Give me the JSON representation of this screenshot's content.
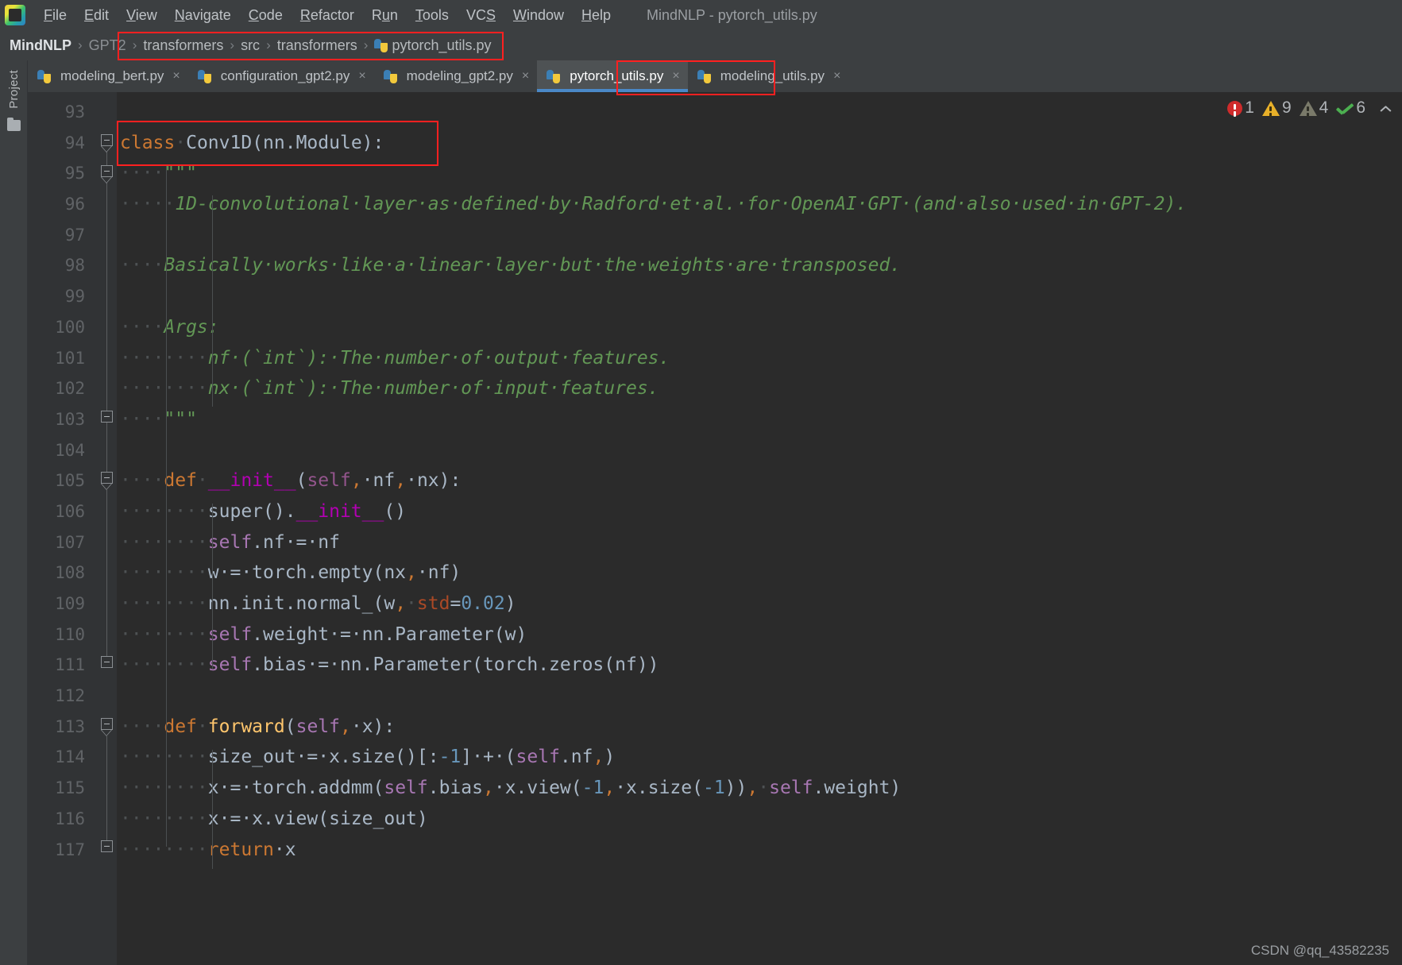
{
  "window": {
    "title": "MindNLP - pytorch_utils.py",
    "app_icon": "pycharm-logo-icon"
  },
  "menubar": {
    "items": [
      {
        "label": "File",
        "mnemonic": "F"
      },
      {
        "label": "Edit",
        "mnemonic": "E"
      },
      {
        "label": "View",
        "mnemonic": "V"
      },
      {
        "label": "Navigate",
        "mnemonic": "N"
      },
      {
        "label": "Code",
        "mnemonic": "C"
      },
      {
        "label": "Refactor",
        "mnemonic": "R"
      },
      {
        "label": "Run",
        "mnemonic": "u"
      },
      {
        "label": "Tools",
        "mnemonic": "T"
      },
      {
        "label": "VCS",
        "mnemonic": "S"
      },
      {
        "label": "Window",
        "mnemonic": "W"
      },
      {
        "label": "Help",
        "mnemonic": "H"
      }
    ]
  },
  "breadcrumb": {
    "separator": "›",
    "items": [
      {
        "label": "MindNLP",
        "style": "root",
        "icon": null
      },
      {
        "label": "GPT2",
        "style": "dim",
        "icon": null
      },
      {
        "label": "transformers",
        "style": "plain",
        "icon": null
      },
      {
        "label": "src",
        "style": "plain",
        "icon": null
      },
      {
        "label": "transformers",
        "style": "plain",
        "icon": null
      },
      {
        "label": "pytorch_utils.py",
        "style": "plain",
        "icon": "python-file-icon"
      }
    ]
  },
  "tabs": [
    {
      "label": "modeling_bert.py",
      "icon": "python-file-icon",
      "active": false,
      "close": "×"
    },
    {
      "label": "configuration_gpt2.py",
      "icon": "python-file-icon",
      "active": false,
      "close": "×"
    },
    {
      "label": "modeling_gpt2.py",
      "icon": "python-file-icon",
      "active": false,
      "close": "×"
    },
    {
      "label": "pytorch_utils.py",
      "icon": "python-file-icon",
      "active": true,
      "close": "×"
    },
    {
      "label": "modeling_utils.py",
      "icon": "python-file-icon",
      "active": false,
      "close": "×"
    }
  ],
  "toolwindow": {
    "project_label": "Project",
    "folder_icon": "folder-icon"
  },
  "inspections": {
    "error_count": "1",
    "warning_count": "9",
    "weak_warning_count": "4",
    "ok_count": "6",
    "collapse_icon": "chevron-up-icon",
    "error_color": "#cf2b2b",
    "warning_color": "#e8b029",
    "weak_warning_color": "#7a7a6a",
    "ok_color": "#4caf50"
  },
  "editor": {
    "first_line_number": 93,
    "line_numbers": [
      93,
      94,
      95,
      96,
      97,
      98,
      99,
      100,
      101,
      102,
      103,
      104,
      105,
      106,
      107,
      108,
      109,
      110,
      111,
      112,
      113,
      114,
      115,
      116,
      117
    ],
    "lines": [
      {
        "n": 93,
        "tokens": []
      },
      {
        "n": 94,
        "tokens": [
          {
            "t": "class",
            "c": "kw"
          },
          {
            "t": "·",
            "c": "ws"
          },
          {
            "t": "Conv1D(nn.Module):",
            "c": "cls"
          }
        ]
      },
      {
        "n": 95,
        "tokens": [
          {
            "t": "····",
            "c": "ws"
          },
          {
            "t": "\"\"\"",
            "c": "doc"
          }
        ]
      },
      {
        "n": 96,
        "tokens": [
          {
            "t": "·····",
            "c": "ws"
          },
          {
            "t": "1D-convolutional·layer·as·defined·by·Radford·et·al.·for·OpenAI·GPT·(and·also·used·in·GPT-2).",
            "c": "doc"
          }
        ]
      },
      {
        "n": 97,
        "tokens": []
      },
      {
        "n": 98,
        "tokens": [
          {
            "t": "····",
            "c": "ws"
          },
          {
            "t": "Basically·works·like·a·linear·layer·but·the·weights·are·transposed.",
            "c": "doc"
          }
        ]
      },
      {
        "n": 99,
        "tokens": []
      },
      {
        "n": 100,
        "tokens": [
          {
            "t": "····",
            "c": "ws"
          },
          {
            "t": "Args:",
            "c": "doc"
          }
        ]
      },
      {
        "n": 101,
        "tokens": [
          {
            "t": "········",
            "c": "ws"
          },
          {
            "t": "nf·(`int`):·The·number·of·output·features.",
            "c": "doc"
          }
        ]
      },
      {
        "n": 102,
        "tokens": [
          {
            "t": "········",
            "c": "ws"
          },
          {
            "t": "nx·(`int`):·The·number·of·input·features.",
            "c": "doc"
          }
        ]
      },
      {
        "n": 103,
        "tokens": [
          {
            "t": "····",
            "c": "ws"
          },
          {
            "t": "\"\"\"",
            "c": "doc"
          }
        ]
      },
      {
        "n": 104,
        "tokens": []
      },
      {
        "n": 105,
        "tokens": [
          {
            "t": "····",
            "c": "ws"
          },
          {
            "t": "def",
            "c": "kw"
          },
          {
            "t": "·",
            "c": "ws"
          },
          {
            "t": "__init__",
            "c": "magic"
          },
          {
            "t": "(",
            "c": "cls"
          },
          {
            "t": "self",
            "c": "self"
          },
          {
            "t": ",",
            "c": "comma"
          },
          {
            "t": "·nf",
            "c": "cls"
          },
          {
            "t": ",",
            "c": "comma"
          },
          {
            "t": "·nx):",
            "c": "cls"
          }
        ]
      },
      {
        "n": 106,
        "tokens": [
          {
            "t": "········",
            "c": "ws"
          },
          {
            "t": "super().",
            "c": "cls"
          },
          {
            "t": "__init__",
            "c": "magic"
          },
          {
            "t": "()",
            "c": "cls"
          }
        ]
      },
      {
        "n": 107,
        "tokens": [
          {
            "t": "········",
            "c": "ws"
          },
          {
            "t": "self",
            "c": "self2"
          },
          {
            "t": ".nf·=·nf",
            "c": "cls"
          }
        ]
      },
      {
        "n": 108,
        "tokens": [
          {
            "t": "········",
            "c": "ws"
          },
          {
            "t": "w·=·torch.empty(nx",
            "c": "cls"
          },
          {
            "t": ",",
            "c": "comma"
          },
          {
            "t": "·nf)",
            "c": "cls"
          }
        ]
      },
      {
        "n": 109,
        "tokens": [
          {
            "t": "········",
            "c": "ws"
          },
          {
            "t": "nn.init.normal_(w",
            "c": "cls"
          },
          {
            "t": ",",
            "c": "comma"
          },
          {
            "t": "·",
            "c": "ws"
          },
          {
            "t": "std",
            "c": "arg"
          },
          {
            "t": "=",
            "c": "cls"
          },
          {
            "t": "0.02",
            "c": "num"
          },
          {
            "t": ")",
            "c": "cls"
          }
        ]
      },
      {
        "n": 110,
        "tokens": [
          {
            "t": "········",
            "c": "ws"
          },
          {
            "t": "self",
            "c": "self2"
          },
          {
            "t": ".weight·=·nn.Parameter(w)",
            "c": "cls"
          }
        ]
      },
      {
        "n": 111,
        "tokens": [
          {
            "t": "········",
            "c": "ws"
          },
          {
            "t": "self",
            "c": "self2"
          },
          {
            "t": ".bias·=·nn.Parameter(torch.zeros(nf))",
            "c": "cls"
          }
        ]
      },
      {
        "n": 112,
        "tokens": []
      },
      {
        "n": 113,
        "tokens": [
          {
            "t": "····",
            "c": "ws"
          },
          {
            "t": "def",
            "c": "kw"
          },
          {
            "t": "·",
            "c": "ws"
          },
          {
            "t": "forward",
            "c": "fn"
          },
          {
            "t": "(",
            "c": "cls"
          },
          {
            "t": "self",
            "c": "self2"
          },
          {
            "t": ",",
            "c": "comma"
          },
          {
            "t": "·x):",
            "c": "cls"
          }
        ]
      },
      {
        "n": 114,
        "tokens": [
          {
            "t": "········",
            "c": "ws"
          },
          {
            "t": "size_out·=·x.size()[:",
            "c": "cls"
          },
          {
            "t": "-1",
            "c": "num"
          },
          {
            "t": "]·+·(",
            "c": "cls"
          },
          {
            "t": "self",
            "c": "self2"
          },
          {
            "t": ".nf",
            "c": "cls"
          },
          {
            "t": ",",
            "c": "comma"
          },
          {
            "t": ")",
            "c": "cls"
          }
        ]
      },
      {
        "n": 115,
        "tokens": [
          {
            "t": "········",
            "c": "ws"
          },
          {
            "t": "x·=·torch.addmm(",
            "c": "cls"
          },
          {
            "t": "self",
            "c": "self2"
          },
          {
            "t": ".bias",
            "c": "cls"
          },
          {
            "t": ",",
            "c": "comma"
          },
          {
            "t": "·x.view(",
            "c": "cls"
          },
          {
            "t": "-1",
            "c": "num"
          },
          {
            "t": ",",
            "c": "comma"
          },
          {
            "t": "·x.size(",
            "c": "cls"
          },
          {
            "t": "-1",
            "c": "num"
          },
          {
            "t": "))",
            "c": "cls"
          },
          {
            "t": ",",
            "c": "comma"
          },
          {
            "t": "·",
            "c": "ws"
          },
          {
            "t": "self",
            "c": "self2"
          },
          {
            "t": ".weight)",
            "c": "cls"
          }
        ]
      },
      {
        "n": 116,
        "tokens": [
          {
            "t": "········",
            "c": "ws"
          },
          {
            "t": "x·=·x.view(size_out)",
            "c": "cls"
          }
        ]
      },
      {
        "n": 117,
        "tokens": [
          {
            "t": "········",
            "c": "ws"
          },
          {
            "t": "return",
            "c": "kw"
          },
          {
            "t": "·x",
            "c": "cls"
          }
        ]
      }
    ],
    "highlight_line": 94,
    "background": "#2b2b2b",
    "gutter_background": "#313335",
    "line_number_color": "#606366"
  },
  "watermark": {
    "text": "CSDN @qq_43582235"
  }
}
